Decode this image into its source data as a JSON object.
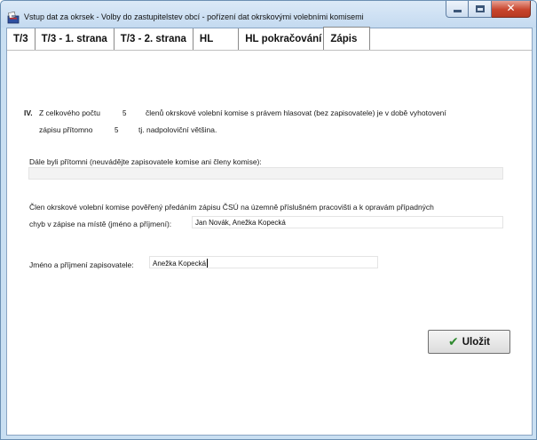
{
  "window": {
    "title": "Vstup dat za okrsek - Volby do zastupitelstev obcí - pořízení dat okrskovými volebními komisemi",
    "icon": "ballot-box-icon",
    "buttons": {
      "minimize": "minimize-icon",
      "maximize": "maximize-icon",
      "close": "✕"
    }
  },
  "tabs": [
    {
      "label": "T/3"
    },
    {
      "label": "T/3 - 1. strana"
    },
    {
      "label": "T/3 - 2. strana"
    },
    {
      "label": "HL"
    },
    {
      "label": "HL pokračování"
    },
    {
      "label": "Zápis",
      "active": true
    }
  ],
  "section": {
    "roman": "IV.",
    "line1_prefix": "Z celkového počtu",
    "total_members": "5",
    "line1_suffix": "členů okrskové volební komise s právem hlasovat (bez zapisovatele) je v době vyhotovení",
    "line2_prefix": "zápisu přítomno",
    "present_members": "5",
    "line2_suffix": "tj. nadpoloviční většina.",
    "others_label": "Dále byli přítomni (neuvádějte zapisovatele komise ani členy komise):",
    "others_value": "",
    "delegate_label_line1": "Člen okrskové volební komise pověřený předáním zápisu ČSÚ na územně příslušném pracovišti a k opravám případných",
    "delegate_label_line2": "chyb v zápise na místě (jméno a příjmení):",
    "delegate_value": "Jan Novák, Anežka Kopecká",
    "recorder_label": "Jméno a příjmení zapisovatele:",
    "recorder_value": "Anežka Kopecká"
  },
  "save_button": {
    "label": "Uložit",
    "icon": "checkmark-icon"
  }
}
